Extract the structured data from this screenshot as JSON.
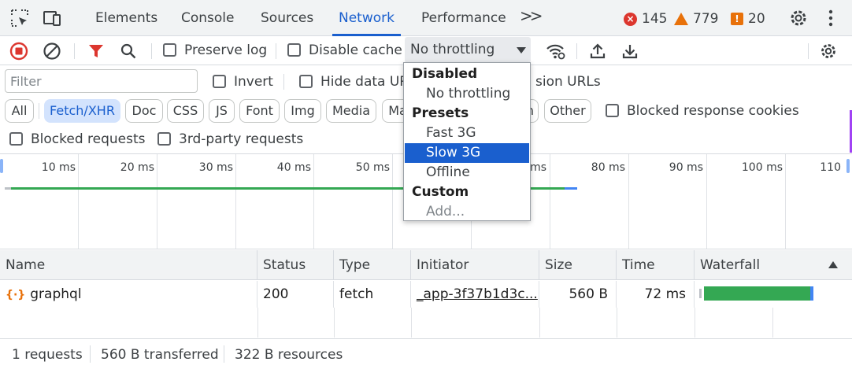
{
  "tabs": {
    "items": [
      "Elements",
      "Console",
      "Sources",
      "Network",
      "Performance"
    ],
    "active": "Network",
    "more": ">>"
  },
  "counts": {
    "errors": "145",
    "warnings": "779",
    "issues": "20"
  },
  "toolbar": {
    "preserve_log": "Preserve log",
    "disable_cache": "Disable cache",
    "throttling_value": "No throttling"
  },
  "filter": {
    "placeholder": "Filter",
    "invert": "Invert",
    "hide_data_urls": "Hide data UR",
    "hide_ext_urls_tail": "sion URLs",
    "blocked_cookies": "Blocked response cookies",
    "blocked_requests": "Blocked requests",
    "third_party": "3rd-party requests"
  },
  "chips": [
    "All",
    "Fetch/XHR",
    "Doc",
    "CSS",
    "JS",
    "Font",
    "Img",
    "Media",
    "Ma",
    "n",
    "Other"
  ],
  "timeline_ticks": [
    "10 ms",
    "20 ms",
    "30 ms",
    "40 ms",
    "50 ms",
    "ms",
    "80 ms",
    "90 ms",
    "100 ms",
    "110"
  ],
  "dropdown": {
    "groups": [
      "Disabled",
      "Presets",
      "Custom"
    ],
    "items": [
      "No throttling",
      "Fast 3G",
      "Slow 3G",
      "Offline",
      "Add..."
    ],
    "highlighted": "Slow 3G"
  },
  "table": {
    "headers": [
      "Name",
      "Status",
      "Type",
      "Initiator",
      "Size",
      "Time",
      "Waterfall"
    ],
    "rows": [
      {
        "name": "graphql",
        "status": "200",
        "type": "fetch",
        "initiator": "_app-3f37b1d3c...",
        "size": "560 B",
        "time": "72 ms"
      }
    ]
  },
  "status": {
    "requests": "1 requests",
    "transferred": "560 B transferred",
    "resources": "322 B resources"
  },
  "colors": {
    "accent": "#1a5fce",
    "error": "#dc362e",
    "warning": "#e8710a",
    "waterfall_green": "#34a853",
    "waterfall_blue": "#4285f4"
  }
}
